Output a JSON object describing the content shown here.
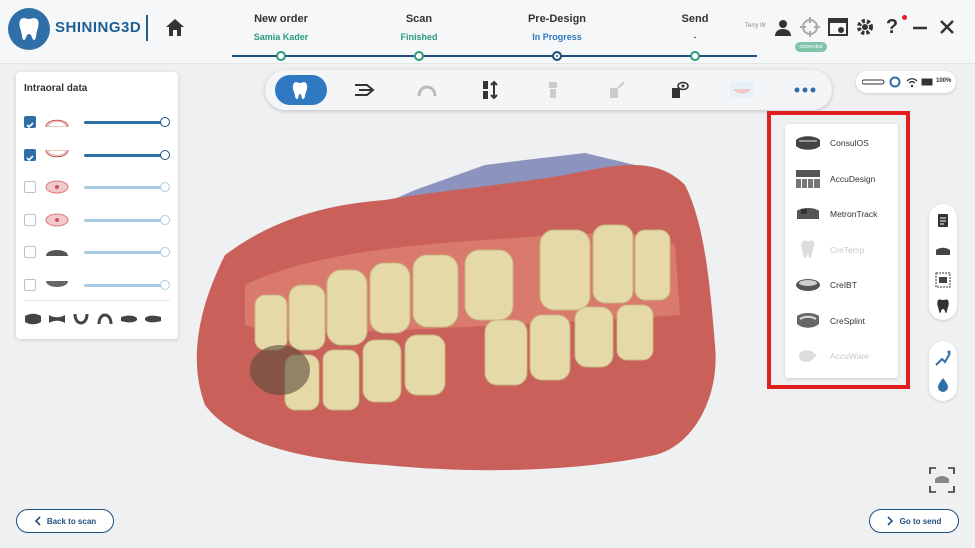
{
  "app": {
    "brand": "SHINING3D"
  },
  "steps": [
    {
      "title": "New order",
      "status": "Samia Kader",
      "color": "#2a9a7d"
    },
    {
      "title": "Scan",
      "status": "Finished",
      "color": "#2a9a7d"
    },
    {
      "title": "Pre-Design",
      "status": "In Progress",
      "color": "#2f78c2"
    },
    {
      "title": "Send",
      "status": "-",
      "color": "#2a9a7d"
    }
  ],
  "header": {
    "user": "Terry W",
    "pill": "connected"
  },
  "left_panel": {
    "title": "Intraoral data",
    "rows": [
      {
        "checked": true,
        "kind": "upper-jaw"
      },
      {
        "checked": true,
        "kind": "lower-jaw"
      },
      {
        "checked": false,
        "kind": "upper-prep"
      },
      {
        "checked": false,
        "kind": "lower-prep"
      },
      {
        "checked": false,
        "kind": "upper-gray"
      },
      {
        "checked": false,
        "kind": "lower-gray"
      }
    ]
  },
  "status": {
    "battery": "100%"
  },
  "popup_items": [
    {
      "label": "ConsulOS",
      "enabled": true
    },
    {
      "label": "AccuDesign",
      "enabled": true
    },
    {
      "label": "MetronTrack",
      "enabled": true
    },
    {
      "label": "CreTemp",
      "enabled": false
    },
    {
      "label": "CreIBT",
      "enabled": true
    },
    {
      "label": "CreSplint",
      "enabled": true
    },
    {
      "label": "AccuWare",
      "enabled": false
    }
  ],
  "buttons": {
    "back": "Back to scan",
    "next": "Go to send"
  },
  "colors": {
    "accent": "#2f78c2",
    "done": "#2a9a7d",
    "highlight": "#e11f1f"
  }
}
